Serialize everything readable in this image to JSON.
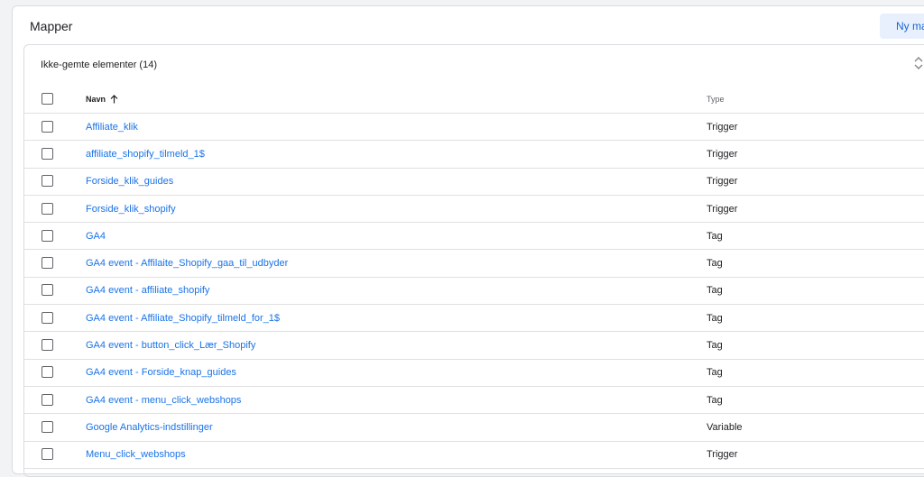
{
  "page": {
    "title": "Mapper",
    "new_button_label": "Ny mappe"
  },
  "section": {
    "title": "Ikke-gemte elementer (14)",
    "collapse_icon": "chevron-up-down-icon"
  },
  "table": {
    "columns": {
      "name": "Navn",
      "type": "Type"
    },
    "sort": "ascending",
    "rows": [
      {
        "name": "Affiliate_klik",
        "type": "Trigger"
      },
      {
        "name": "affiliate_shopify_tilmeld_1$",
        "type": "Trigger"
      },
      {
        "name": "Forside_klik_guides",
        "type": "Trigger"
      },
      {
        "name": "Forside_klik_shopify",
        "type": "Trigger"
      },
      {
        "name": "GA4",
        "type": "Tag"
      },
      {
        "name": "GA4 event - Affilaite_Shopify_gaa_til_udbyder",
        "type": "Tag"
      },
      {
        "name": "GA4 event - affiliate_shopify",
        "type": "Tag"
      },
      {
        "name": "GA4 event - Affiliate_Shopify_tilmeld_for_1$",
        "type": "Tag"
      },
      {
        "name": "GA4 event - button_click_Lær_Shopify",
        "type": "Tag"
      },
      {
        "name": "GA4 event - Forside_knap_guides",
        "type": "Tag"
      },
      {
        "name": "GA4 event - menu_click_webshops",
        "type": "Tag"
      },
      {
        "name": "Google Analytics-indstillinger",
        "type": "Variable"
      },
      {
        "name": "Menu_click_webshops",
        "type": "Trigger"
      }
    ]
  },
  "colors": {
    "link": "#1a73e8",
    "button_bg": "#e8f0fe",
    "border": "#dadce0"
  }
}
